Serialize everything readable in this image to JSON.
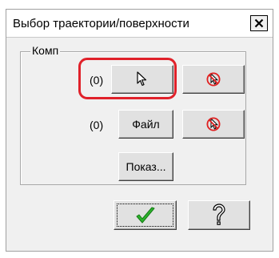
{
  "window": {
    "title": "Выбор траектории/поверхности",
    "close_glyph": "✕"
  },
  "group": {
    "label": "Комп",
    "row1": {
      "count": "(0)",
      "pick_icon": "cursor-pointer-icon",
      "clear_icon": "cursor-prohibited-icon"
    },
    "row2": {
      "count": "(0)",
      "file_label": "Файл",
      "clear_icon": "cursor-prohibited-icon"
    },
    "show_label": "Показ..."
  },
  "footer": {
    "ok_icon": "green-checkmark-icon",
    "help_icon": "question-mark-icon"
  },
  "colors": {
    "highlight": "#e0212a",
    "checkmark": "#2db42d",
    "prohibit": "#e02020"
  }
}
